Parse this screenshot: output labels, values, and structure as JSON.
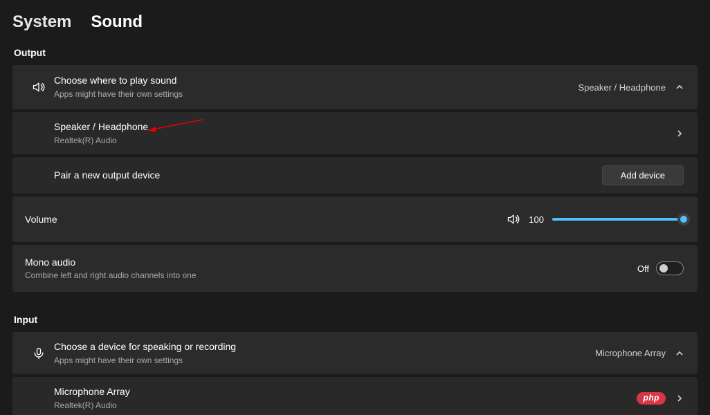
{
  "breadcrumb": {
    "parent": "System",
    "current": "Sound"
  },
  "output_section": "Output",
  "choose_output": {
    "title": "Choose where to play sound",
    "sub": "Apps might have their own settings",
    "value": "Speaker / Headphone"
  },
  "output_device": {
    "title": "Speaker / Headphone",
    "sub": "Realtek(R) Audio"
  },
  "pair": {
    "label": "Pair a new output device",
    "button": "Add device"
  },
  "volume": {
    "label": "Volume",
    "value": "100",
    "percent": 100
  },
  "mono": {
    "title": "Mono audio",
    "sub": "Combine left and right audio channels into one",
    "state": "Off"
  },
  "input_section": "Input",
  "choose_input": {
    "title": "Choose a device for speaking or recording",
    "sub": "Apps might have their own settings",
    "value": "Microphone Array"
  },
  "input_device": {
    "title": "Microphone Array",
    "sub": "Realtek(R) Audio"
  },
  "badge": "php"
}
